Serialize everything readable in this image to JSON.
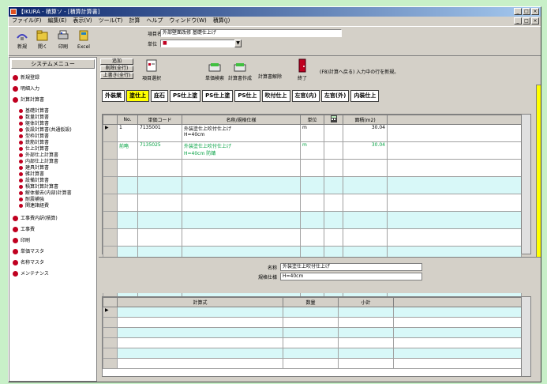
{
  "window": {
    "title": "【IKURA - 積算ソ - [積算計算書]",
    "minimize": "_",
    "maximize": "□",
    "close": "×"
  },
  "menu": [
    "ファイル(F)",
    "編集(E)",
    "表示(V)",
    "ツール(T)",
    "計算",
    "ヘルプ",
    "ウィンドウ(W)",
    "積算(J)"
  ],
  "toolbar": {
    "tools": [
      {
        "label": "新規",
        "icon": "new-icon"
      },
      {
        "label": "開く",
        "icon": "folder-icon"
      },
      {
        "label": "印刷",
        "icon": "print-icon"
      },
      {
        "label": "Excel",
        "icon": "excel-icon"
      }
    ],
    "field1_label": "項目名",
    "field1_value": "外部壁面改修 基礎仕上げ",
    "field2_label": "単位",
    "field2_value": "■"
  },
  "sidebar": {
    "header": "システムメニュー",
    "items": [
      {
        "label": "新規登録",
        "small": false
      },
      {
        "label": "明細入力",
        "small": false
      },
      {
        "label": "計算計算書",
        "small": false
      },
      {
        "label": "基礎計算書",
        "small": true
      },
      {
        "label": "数量計算書",
        "small": true
      },
      {
        "label": "躯体計算書",
        "small": true
      },
      {
        "label": "仮設計算書(共通仮設)",
        "small": true
      },
      {
        "label": "型枠計算書",
        "small": true
      },
      {
        "label": "鉄筋計算書",
        "small": true
      },
      {
        "label": "仕上計算書",
        "small": true
      },
      {
        "label": "外部仕上計算書",
        "small": true
      },
      {
        "label": "内部仕上計算書",
        "small": true
      },
      {
        "label": "建具計算書",
        "small": true
      },
      {
        "label": "雑計算書",
        "small": true
      },
      {
        "label": "設備計算書",
        "small": true
      },
      {
        "label": "積算計算計算書",
        "small": true
      },
      {
        "label": "解体撤去(内部)計算書",
        "small": true
      },
      {
        "label": "耐震補強",
        "small": true
      },
      {
        "label": "関連諸経費",
        "small": true
      },
      {
        "label": "工事費内訳(積算)",
        "small": false
      },
      {
        "label": "工事費",
        "small": false
      },
      {
        "label": "印刷",
        "small": false
      },
      {
        "label": "単価マスタ",
        "small": false
      },
      {
        "label": "名称マスタ",
        "small": false
      },
      {
        "label": "メンテナンス",
        "small": false
      }
    ]
  },
  "controls": {
    "btn1": "追加",
    "btn2": "削除(全行)",
    "btn3": "上書き(全行)",
    "icons": [
      {
        "label": "項目選択",
        "icon": "select-icon"
      },
      {
        "label": "単価検索",
        "icon": "search-icon"
      },
      {
        "label": "計算書作成",
        "icon": "calc-icon"
      },
      {
        "label": "計算書解除",
        "icon": "uncalc-icon"
      },
      {
        "label": "終了",
        "icon": "exit-icon"
      }
    ],
    "status": "(F8)計算へ戻る) 入力中の行を新規。"
  },
  "tabs": [
    "外装業",
    "塗仕上",
    "庇石",
    "PS仕上塗",
    "PS仕上塗",
    "PS仕上",
    "吹付仕上",
    "左官(内)",
    "左官(外)",
    "内装仕上"
  ],
  "active_tab": 1,
  "grid": {
    "headers": [
      "No.",
      "単価コード",
      "名称/規格仕様",
      "単位",
      "",
      "面積(m2)"
    ],
    "rows": [
      {
        "no": "1",
        "code": "7135001",
        "name": "外装塗仕上吹付仕上げ",
        "spec": "H=40cm",
        "unit": "m",
        "qty": "30.04",
        "color": "black"
      },
      {
        "no": "前略",
        "code": "7135025",
        "name": "外装塗仕上吹付仕上げ",
        "spec": "H=40cm 防錆",
        "unit": "m",
        "qty": "30.04",
        "color": "green"
      },
      {
        "no": "",
        "code": "",
        "name": "",
        "spec": "",
        "unit": "",
        "qty": "",
        "color": "black"
      },
      {
        "no": "",
        "code": "",
        "name": "",
        "spec": "",
        "unit": "",
        "qty": "",
        "color": "black"
      },
      {
        "no": "",
        "code": "",
        "name": "",
        "spec": "",
        "unit": "",
        "qty": "",
        "color": "black"
      },
      {
        "no": "",
        "code": "",
        "name": "",
        "spec": "",
        "unit": "",
        "qty": "",
        "color": "black"
      },
      {
        "no": "",
        "code": "",
        "name": "",
        "spec": "",
        "unit": "",
        "qty": "",
        "color": "black"
      },
      {
        "no": "",
        "code": "",
        "name": "",
        "spec": "",
        "unit": "",
        "qty": "",
        "color": "black"
      },
      {
        "no": "",
        "code": "",
        "name": "",
        "spec": "",
        "unit": "",
        "qty": "",
        "color": "black"
      },
      {
        "no": "",
        "code": "",
        "name": "",
        "spec": "",
        "unit": "",
        "qty": "",
        "color": "black"
      }
    ]
  },
  "info": {
    "label1": "名称",
    "value1": "外装塗仕上吹付仕上げ",
    "label2": "規格仕様",
    "value2": "H=40cm"
  },
  "grid2": {
    "headers": [
      "計算式",
      "数量",
      "小計"
    ]
  }
}
